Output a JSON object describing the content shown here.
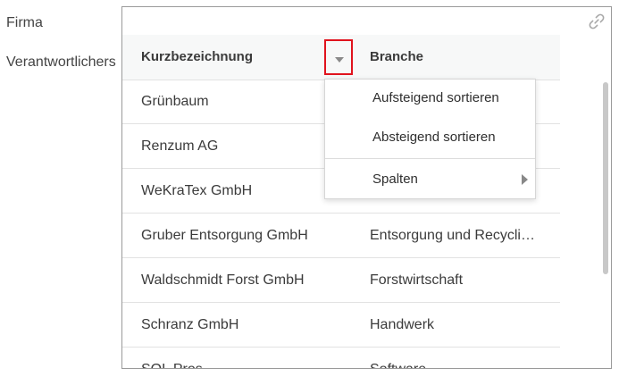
{
  "form": {
    "firma_label": "Firma",
    "verantwortlicher_label": "Verantwortlichers"
  },
  "grid": {
    "columns": {
      "kurzbezeichnung": "Kurzbezeichnung",
      "branche": "Branche"
    },
    "rows": [
      {
        "kurz": "Grünbaum",
        "branche": ""
      },
      {
        "kurz": "Renzum AG",
        "branche": ""
      },
      {
        "kurz": "WeKraTex GmbH",
        "branche": ""
      },
      {
        "kurz": "Gruber Entsorgung GmbH",
        "branche": "Entsorgung und Recycli…"
      },
      {
        "kurz": "Waldschmidt Forst GmbH",
        "branche": "Forstwirtschaft"
      },
      {
        "kurz": "Schranz GmbH",
        "branche": "Handwerk"
      },
      {
        "kurz": "SQL Pros",
        "branche": "Software"
      }
    ]
  },
  "column_menu": {
    "sort_ascending": "Aufsteigend sortieren",
    "sort_descending": "Absteigend sortieren",
    "columns": "Spalten"
  },
  "colors": {
    "highlight_border": "#e0131d",
    "header_bg": "#f7f8f8",
    "row_divider": "#e2e2e2"
  }
}
